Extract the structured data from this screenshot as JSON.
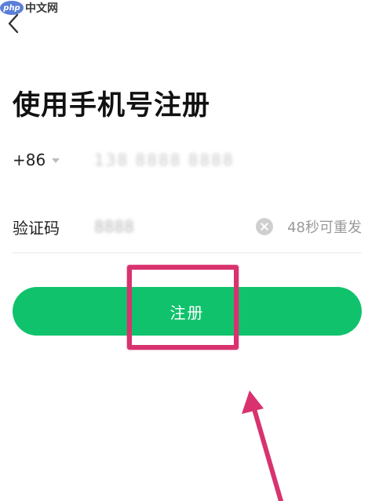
{
  "watermark": {
    "logo": "php",
    "text": "中文网"
  },
  "page": {
    "title": "使用手机号注册"
  },
  "phone_row": {
    "country_code": "+86",
    "number": "138 8888 8888"
  },
  "code_row": {
    "label": "验证码",
    "value": "8888",
    "resend": "48秒可重发"
  },
  "register_button": {
    "label": "注册"
  },
  "colors": {
    "primary": "#11c26d",
    "annotation": "#d8336f"
  }
}
